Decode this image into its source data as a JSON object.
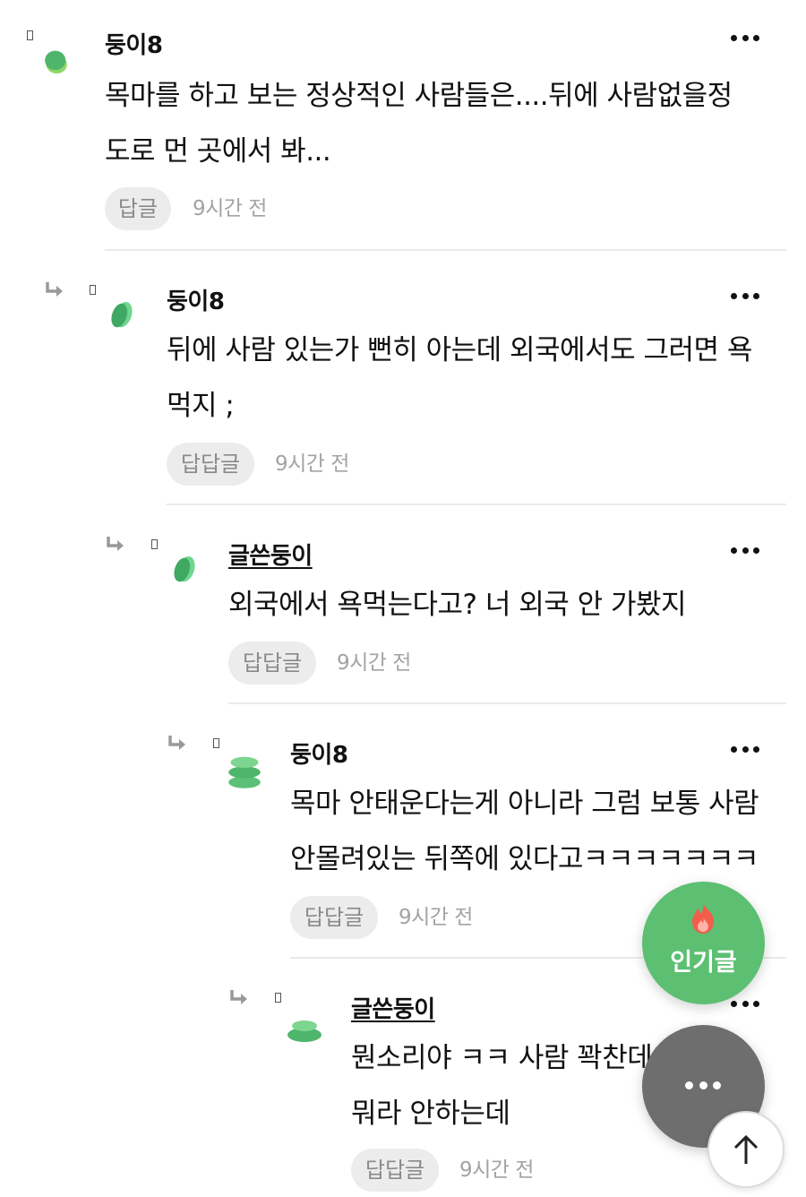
{
  "comments": [
    {
      "author": "둥이8",
      "lines": [
        "목마를 하고 보는 정상적인 사람들은....뒤에 사람없을정",
        "도로 먼 곳에서 봐..."
      ],
      "reply_label": "답글",
      "time": "9시간 전"
    },
    {
      "author": "둥이8",
      "lines": [
        "뒤에 사람 있는가 뻔히 아는데 외국에서도 그러면 욕",
        "먹지 ;"
      ],
      "reply_label": "답답글",
      "time": "9시간 전"
    },
    {
      "author": "글쓴둥이",
      "lines": [
        "외국에서 욕먹는다고? 너 외국 안 가봤지"
      ],
      "reply_label": "답답글",
      "time": "9시간 전"
    },
    {
      "author": "둥이8",
      "lines": [
        "목마 안태운다는게 아니라 그럼 보통 사람",
        "안몰려있는 뒤쪽에 있다고ㅋㅋㅋㅋㅋㅋㅋ"
      ],
      "reply_label": "답답글",
      "time": "9시간 전"
    },
    {
      "author": "글쓴둥이",
      "lines": [
        "뭔소리야 ㅋㅋ 사람 꽉찬데에서도",
        "뭐라 안하는데"
      ],
      "reply_label": "답답글",
      "time": "9시간 전"
    }
  ],
  "fab": {
    "popular_label": "인기글",
    "more_icon": "more-dots-icon",
    "top_icon": "arrow-up-icon"
  },
  "colors": {
    "accent_green": "#5cbf72",
    "fab_gray": "#6e6e6e",
    "reply_bg": "#ececec",
    "meta_text": "#a3a3a3"
  }
}
